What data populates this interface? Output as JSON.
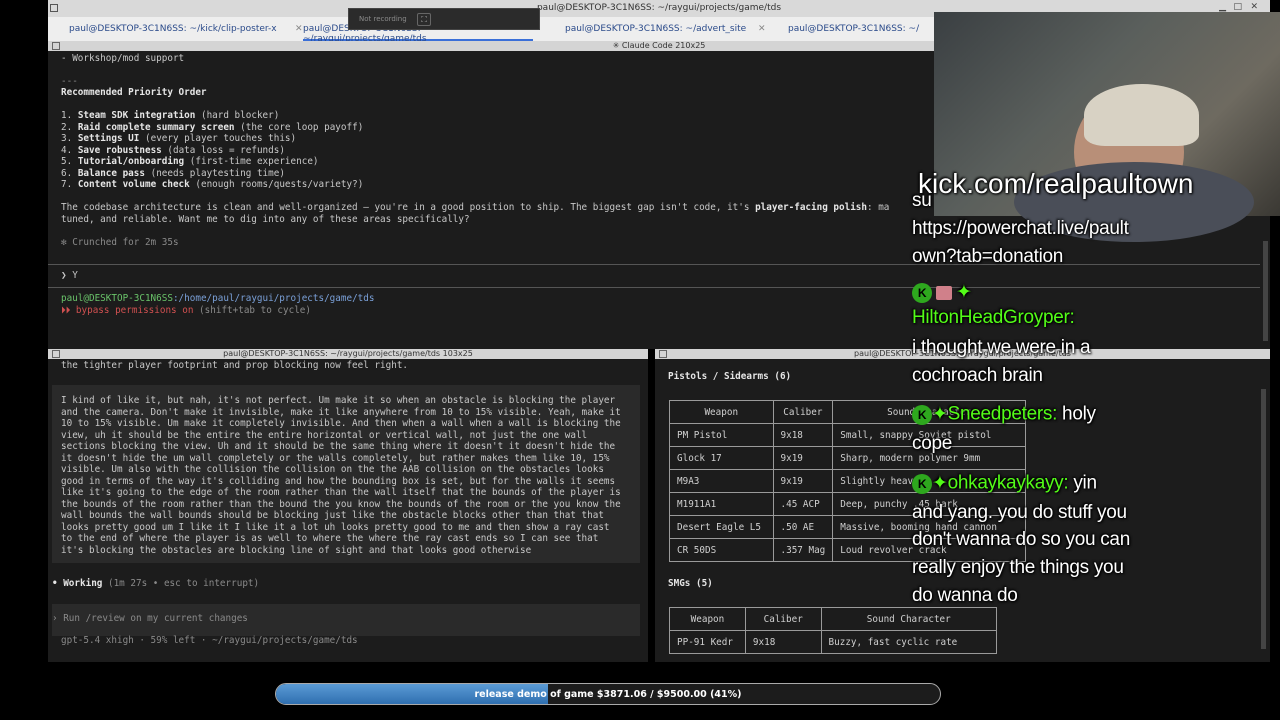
{
  "window": {
    "title": "paul@DESKTOP-3C1N6SS: ~/raygui/projects/game/tds"
  },
  "recording": {
    "label": "Not recording"
  },
  "tabs": [
    {
      "label": "paul@DESKTOP-3C1N6SS: ~/kick/clip-poster-x"
    },
    {
      "label": "paul@DESKTOP-3C1N6SS: ~/raygui/projects/game/tds"
    },
    {
      "label": "paul@DESKTOP-3C1N6SS: ~/advert_site"
    },
    {
      "label": "paul@DESKTOP-3C1N6SS: ~/"
    }
  ],
  "top_pane": {
    "header": "✳ Claude Code 210x25",
    "lines": [
      "- Workshop/mod support",
      "---",
      "Recommended Priority Order"
    ],
    "priorities": [
      {
        "num": "1.",
        "title": "Steam SDK integration",
        "note": "(hard blocker)"
      },
      {
        "num": "2.",
        "title": "Raid complete summary screen",
        "note": "(the core loop payoff)"
      },
      {
        "num": "3.",
        "title": "Settings UI",
        "note": "(every player touches this)"
      },
      {
        "num": "4.",
        "title": "Save robustness",
        "note": "(data loss = refunds)"
      },
      {
        "num": "5.",
        "title": "Tutorial/onboarding",
        "note": "(first-time experience)"
      },
      {
        "num": "6.",
        "title": "Balance pass",
        "note": "(needs playtesting time)"
      },
      {
        "num": "7.",
        "title": "Content volume check",
        "note": "(enough rooms/quests/variety?)"
      }
    ],
    "summary_a": "The codebase architecture is clean and well-organized — you're in a good position to ship. The biggest gap isn't code, it's ",
    "summary_bold": "player-facing polish",
    "summary_b": ": ma",
    "summary_2": "tuned, and reliable. Want me to dig into any of these areas specifically?",
    "crunched": "✻ Crunched for 2m 35s",
    "prompt": "❯ Y",
    "prompt_user": "paul@DESKTOP-3C1N6SS",
    "prompt_path": ":/home/paul/raygui/projects/game/tds",
    "bypass_icon": "⏵⏵",
    "bypass": " bypass permissions on",
    "bypass_hint": " (shift+tab to cycle)"
  },
  "left_pane": {
    "header": "paul@DESKTOP-3C1N6SS: ~/raygui/projects/game/tds 103x25",
    "first_line": "the tighter player footprint and prop blocking now feel right.",
    "message": [
      "I kind of like it, but nah, it's not perfect. Um make it so when an obstacle is blocking the player",
      "and the camera. Don't make it invisible, make it like anywhere from 10 to 15% visible. Yeah, make it",
      "10 to 15% visible. Um make it completely invisible. And then when a wall when a wall is blocking the",
      "view, uh it should be the entire the entire horizontal or vertical wall, not just the one wall",
      "sections blocking the view. Uh and it should be the same thing where it doesn't it doesn't hide the",
      "it doesn't hide the um wall completely or the walls completely, but rather makes them like 10, 15%",
      "visible. Um also with the collision the collision on the the AAB collision on the obstacles looks",
      "good in terms of the way it's colliding and how the bounding box is set, but for the walls it seems",
      "like it's going to the edge of the room rather than the wall itself that the bounds of the player is",
      "the bounds of the room rather than the bound the you know the bounds of the room or the you know the",
      "wall bounds the wall bounds should be blocking just like the obstacle blocks other than that that",
      "looks pretty good um I like it I like it a lot uh looks pretty good to me and then show a ray cast",
      "to the end of where the player is as well to where the where the ray cast ends so I can see that",
      "it's blocking the obstacles are blocking line of sight and that looks good otherwise"
    ],
    "working": "Working",
    "working_hint": " (1m 27s • esc to interrupt)",
    "input_placeholder": "› Run /review on my current changes",
    "status": "gpt-5.4 xhigh · 59% left · ~/raygui/projects/game/tds"
  },
  "right_pane": {
    "header": "paul@DESKTOP-3C1N6SS: ~/raygui/projects/game/tds",
    "section1": "Pistols / Sidearms (6)",
    "table1": {
      "headers": [
        "Weapon",
        "Caliber",
        "Sound Character"
      ],
      "rows": [
        [
          "PM Pistol",
          "9x18",
          "Small, snappy Soviet pistol"
        ],
        [
          "Glock 17",
          "9x19",
          "Sharp, modern polymer 9mm"
        ],
        [
          "M9A3",
          "9x19",
          "Slightly heavier"
        ],
        [
          "M1911A1",
          ".45 ACP",
          "Deep, punchy .45 bark"
        ],
        [
          "Desert Eagle L5",
          ".50 AE",
          "Massive, booming hand cannon"
        ],
        [
          "CR 50DS",
          ".357 Mag",
          "Loud revolver crack"
        ]
      ]
    },
    "section2": "SMGs (5)",
    "table2": {
      "headers": [
        "Weapon",
        "Caliber",
        "Sound Character"
      ],
      "rows": [
        [
          "PP-91 Kedr",
          "9x18",
          "Buzzy, fast cyclic rate"
        ]
      ]
    }
  },
  "overlay": {
    "kick_url": "kick.com/realpaultown",
    "donation_partial": "su",
    "donation_line1": "https://powerchat.live/pault",
    "donation_line2": "own?tab=donation",
    "chat": [
      {
        "user": "HiltonHeadGroyper:",
        "lines": [
          "i thought we were in a",
          "cochroach brain"
        ]
      },
      {
        "user": "Sneedpeters:",
        "lines": [
          "holy",
          "cope"
        ]
      },
      {
        "user": "ohkaykaykayy:",
        "lines": [
          "yin",
          "and yang. you do stuff you",
          "don't wanna do so you can",
          "really enjoy the things you",
          "do wanna do"
        ]
      }
    ]
  },
  "goal": {
    "label": "release demo of game $3871.06 / $9500.00 (41%)",
    "progress": 0.41
  },
  "colors": {
    "kick_green": "#53fc18",
    "goal_blue": "#4a8cd0",
    "terminal_bg": "#1c1c1c"
  }
}
